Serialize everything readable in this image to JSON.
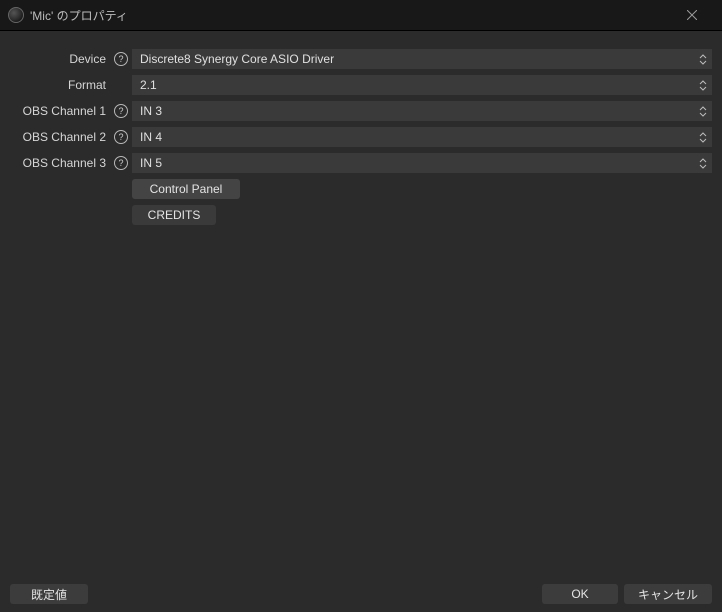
{
  "window": {
    "title": "'Mic' のプロパティ"
  },
  "labels": {
    "device": "Device",
    "format": "Format",
    "obs_channel_1": "OBS Channel 1",
    "obs_channel_2": "OBS Channel 2",
    "obs_channel_3": "OBS Channel 3"
  },
  "values": {
    "device": "Discrete8 Synergy Core ASIO Driver",
    "format": "2.1",
    "obs_channel_1": "IN 3",
    "obs_channel_2": "IN 4",
    "obs_channel_3": "IN 5"
  },
  "buttons": {
    "control_panel": "Control Panel",
    "credits": "CREDITS",
    "defaults": "既定値",
    "ok": "OK",
    "cancel": "キャンセル"
  }
}
